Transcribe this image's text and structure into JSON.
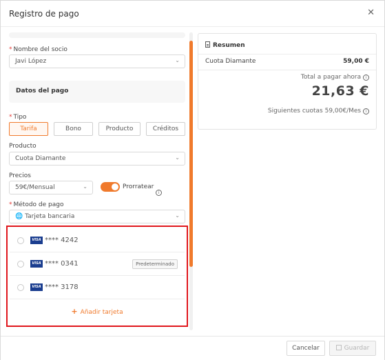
{
  "modal": {
    "title": "Registro de pago"
  },
  "form": {
    "partner": {
      "label": "Nombre del socio",
      "value": "Javi López"
    },
    "section_title": "Datos del pago",
    "type": {
      "label": "Tipo",
      "options": [
        "Tarifa",
        "Bono",
        "Producto",
        "Créditos"
      ],
      "selected": "Tarifa"
    },
    "product": {
      "label": "Producto",
      "value": "Cuota Diamante"
    },
    "prices": {
      "label": "Precios",
      "value": "59€/Mensual",
      "prorate_label": "Prorratear",
      "prorate_on": true
    },
    "payment_method": {
      "label": "Método de pago",
      "value": "Tarjeta bancaria"
    },
    "cards": [
      {
        "brand": "VISA",
        "number": "**** 4242",
        "badge": ""
      },
      {
        "brand": "VISA",
        "number": "**** 0341",
        "badge": "Predeterminado"
      },
      {
        "brand": "VISA",
        "number": "**** 3178",
        "badge": ""
      }
    ],
    "add_card_label": "Añadir tarjeta"
  },
  "summary": {
    "title": "Resumen",
    "item_name": "Cuota Diamante",
    "item_price": "59,00 €",
    "total_label": "Total a pagar ahora",
    "total_amount": "21,63 €",
    "next_fees": "Siguientes cuotas 59,00€/Mes"
  },
  "footer": {
    "cancel_label": "Cancelar",
    "save_label": "Guardar"
  },
  "colors": {
    "accent": "#f07a2c",
    "highlight_border": "#e0151b"
  }
}
